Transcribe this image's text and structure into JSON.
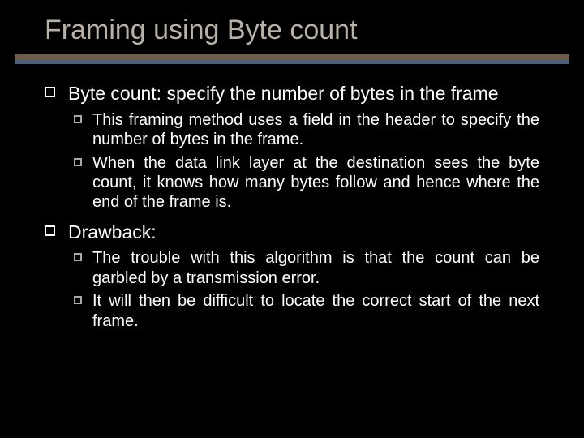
{
  "title": "Framing using Byte count",
  "sections": [
    {
      "heading": "Byte count: specify the number of bytes in the frame",
      "subitems": [
        "This framing method uses a field in the header to specify the number of bytes in the frame.",
        "When the data link layer at the destination sees the byte count, it knows how many bytes follow and hence where the end of the frame is."
      ]
    },
    {
      "heading": "Drawback:",
      "subitems": [
        "The trouble with this algorithm is that the count can be garbled by a transmission error.",
        "It will then be difficult to locate the correct start of the next frame."
      ]
    }
  ]
}
